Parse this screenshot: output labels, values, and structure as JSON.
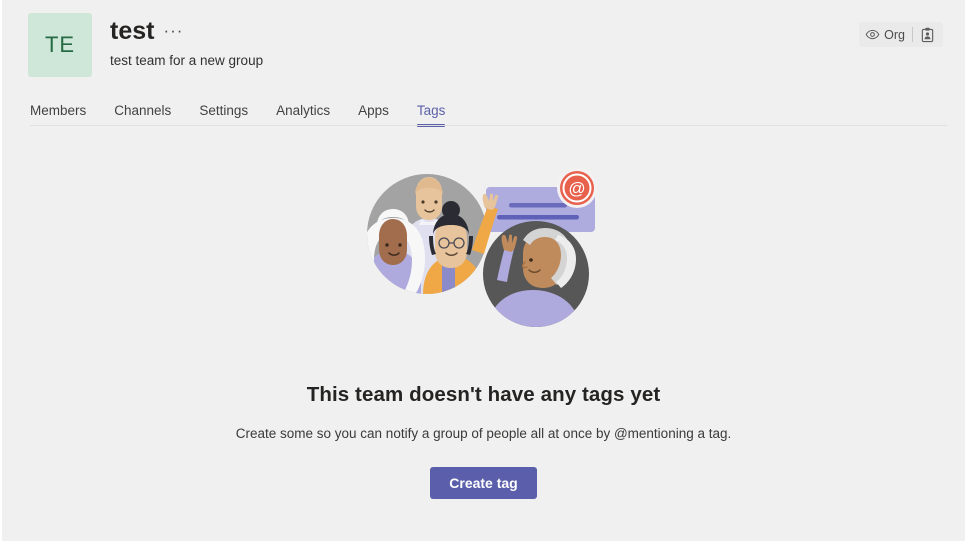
{
  "team": {
    "avatar_initials": "TE",
    "avatar_bg": "#cfe7d8",
    "avatar_fg": "#256b45",
    "name": "test",
    "more_icon": "ellipsis-icon",
    "more_glyph": "···",
    "description": "test team for a new group"
  },
  "org_pill": {
    "eye_icon": "eye-icon",
    "label": "Org",
    "clipboard_icon": "clipboard-person-icon"
  },
  "tabs": [
    {
      "label": "Members",
      "active": false
    },
    {
      "label": "Channels",
      "active": false
    },
    {
      "label": "Settings",
      "active": false
    },
    {
      "label": "Analytics",
      "active": false
    },
    {
      "label": "Apps",
      "active": false
    },
    {
      "label": "Tags",
      "active": true
    }
  ],
  "empty_state": {
    "illustration": "people-tag-mention-illustration",
    "title": "This team doesn't have any tags yet",
    "subtitle": "Create some so you can notify a group of people all at once by @mentioning a tag.",
    "button_label": "Create tag",
    "mention_badge_glyph": "@"
  },
  "colors": {
    "accent": "#5b5fa8",
    "button": "#5b5fab",
    "page_bg": "#f0f0f0",
    "mention_badge": "#e8614d",
    "card_lilac": "#aeabde",
    "circle_gray": "#a3a3a3",
    "circle_dark": "#575757",
    "orange": "#f0a847",
    "periwinkle": "#aeaade"
  }
}
